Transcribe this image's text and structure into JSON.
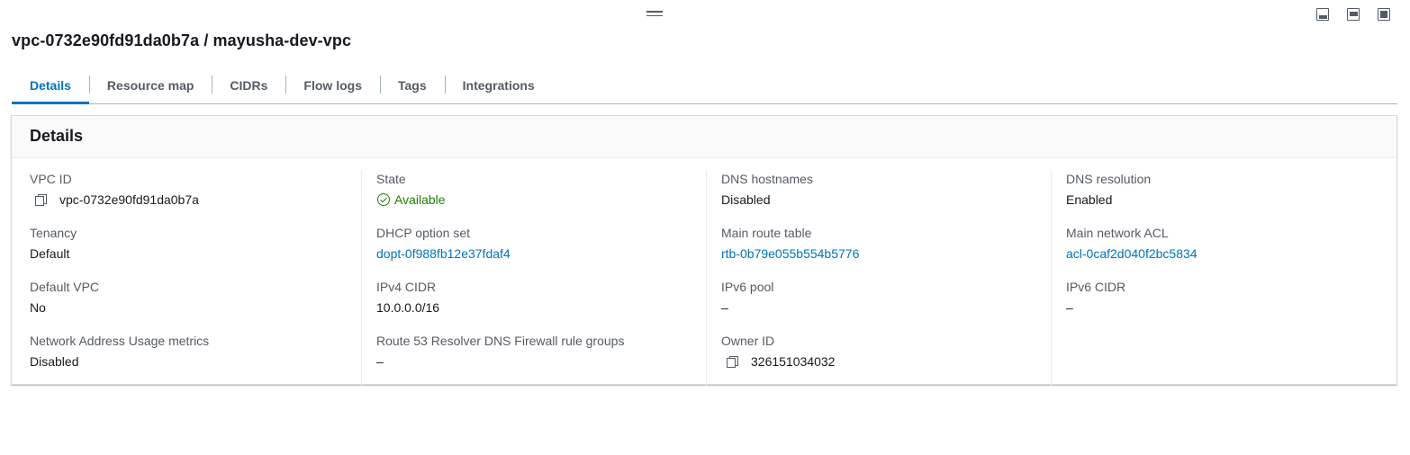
{
  "page": {
    "title": "vpc-0732e90fd91da0b7a / mayusha-dev-vpc"
  },
  "tabs": [
    {
      "label": "Details",
      "active": true
    },
    {
      "label": "Resource map"
    },
    {
      "label": "CIDRs"
    },
    {
      "label": "Flow logs"
    },
    {
      "label": "Tags"
    },
    {
      "label": "Integrations"
    }
  ],
  "panel": {
    "heading": "Details"
  },
  "fields": {
    "vpc_id": {
      "label": "VPC ID",
      "value": "vpc-0732e90fd91da0b7a"
    },
    "state": {
      "label": "State",
      "value": "Available"
    },
    "dns_hostnames": {
      "label": "DNS hostnames",
      "value": "Disabled"
    },
    "dns_resolution": {
      "label": "DNS resolution",
      "value": "Enabled"
    },
    "tenancy": {
      "label": "Tenancy",
      "value": "Default"
    },
    "dhcp_option_set": {
      "label": "DHCP option set",
      "value": "dopt-0f988fb12e37fdaf4"
    },
    "main_route_table": {
      "label": "Main route table",
      "value": "rtb-0b79e055b554b5776"
    },
    "main_network_acl": {
      "label": "Main network ACL",
      "value": "acl-0caf2d040f2bc5834"
    },
    "default_vpc": {
      "label": "Default VPC",
      "value": "No"
    },
    "ipv4_cidr": {
      "label": "IPv4 CIDR",
      "value": "10.0.0.0/16"
    },
    "ipv6_pool": {
      "label": "IPv6 pool",
      "value": "–"
    },
    "ipv6_cidr": {
      "label": "IPv6 CIDR",
      "value": "–"
    },
    "nau_metrics": {
      "label": "Network Address Usage metrics",
      "value": "Disabled"
    },
    "route53_firewall": {
      "label": "Route 53 Resolver DNS Firewall rule groups",
      "value": "–"
    },
    "owner_id": {
      "label": "Owner ID",
      "value": "326151034032"
    }
  },
  "colors": {
    "link": "#0073bb",
    "success": "#1d8102",
    "tab_active": "#0073bb"
  },
  "icons": [
    "drag-handle-icon",
    "layout-bottom-icon",
    "layout-middle-icon",
    "layout-full-icon",
    "copy-icon",
    "check-circle-icon"
  ]
}
